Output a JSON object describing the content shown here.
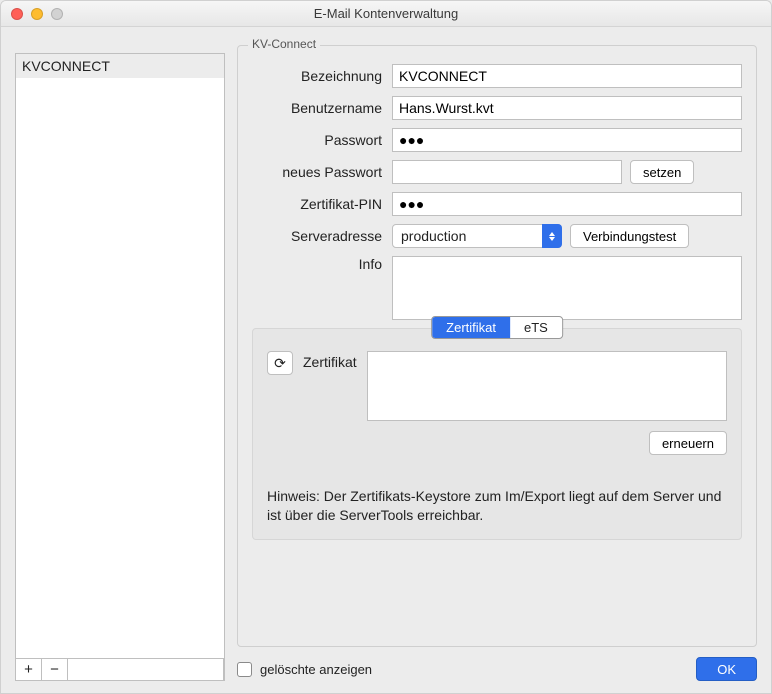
{
  "window": {
    "title": "E-Mail Kontenverwaltung"
  },
  "sidebar": {
    "items": [
      "KVCONNECT"
    ],
    "add_icon_label": "+",
    "remove_icon_label": "−"
  },
  "group": {
    "title": "KV-Connect",
    "labels": {
      "bezeichnung": "Bezeichnung",
      "benutzername": "Benutzername",
      "passwort": "Passwort",
      "neues_passwort": "neues Passwort",
      "zertifikat_pin": "Zertifikat-PIN",
      "serveradresse": "Serveradresse",
      "info": "Info"
    },
    "values": {
      "bezeichnung": "KVCONNECT",
      "benutzername": "Hans.Wurst.kvt",
      "passwort": "●●●",
      "neues_passwort": "",
      "zertifikat_pin": "●●●",
      "serveradresse": "production",
      "info": ""
    },
    "buttons": {
      "setzen": "setzen",
      "verbindungstest": "Verbindungstest"
    }
  },
  "cert": {
    "tabs": {
      "zertifikat": "Zertifikat",
      "ets": "eTS"
    },
    "label": "Zertifikat",
    "reload_glyph": "⟳",
    "value": "",
    "erneuern": "erneuern",
    "hint": "Hinweis: Der Zertifikats-Keystore zum Im/Export liegt auf dem Server und ist über die ServerTools erreichbar."
  },
  "footer": {
    "show_deleted": "gelöschte anzeigen",
    "ok": "OK"
  }
}
